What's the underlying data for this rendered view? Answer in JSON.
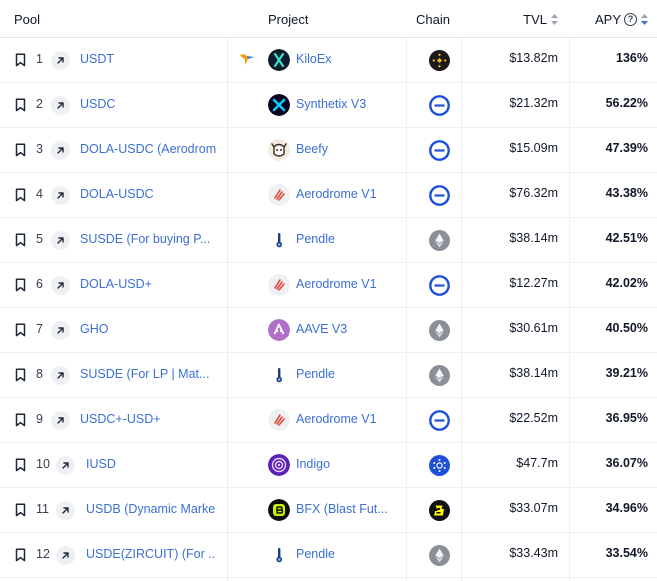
{
  "header": {
    "pool": "Pool",
    "project": "Project",
    "chain": "Chain",
    "tvl": "TVL",
    "apy": "APY",
    "apy_info_icon": "info-icon"
  },
  "colors": {
    "link": "#3b6fd6",
    "text": "#111827",
    "separator": "#eceef2"
  },
  "rows": [
    {
      "rank": "1",
      "pool": "USDT",
      "project": "KiloEx",
      "chain": "BNB Chain",
      "tvl": "$13.82m",
      "apy": "136%"
    },
    {
      "rank": "2",
      "pool": "USDC",
      "project": "Synthetix V3",
      "chain": "Base",
      "tvl": "$21.32m",
      "apy": "56.22%"
    },
    {
      "rank": "3",
      "pool": "DOLA-USDC (Aerodrome",
      "project": "Beefy",
      "chain": "Base",
      "tvl": "$15.09m",
      "apy": "47.39%"
    },
    {
      "rank": "4",
      "pool": "DOLA-USDC",
      "project": "Aerodrome V1",
      "chain": "Base",
      "tvl": "$76.32m",
      "apy": "43.38%"
    },
    {
      "rank": "5",
      "pool": "SUSDE (For buying P...",
      "project": "Pendle",
      "chain": "Ethereum",
      "tvl": "$38.14m",
      "apy": "42.51%"
    },
    {
      "rank": "6",
      "pool": "DOLA-USD+",
      "project": "Aerodrome V1",
      "chain": "Base",
      "tvl": "$12.27m",
      "apy": "42.02%"
    },
    {
      "rank": "7",
      "pool": "GHO",
      "project": "AAVE V3",
      "chain": "Ethereum",
      "tvl": "$30.61m",
      "apy": "40.50%"
    },
    {
      "rank": "8",
      "pool": "SUSDE (For LP | Mat...",
      "project": "Pendle",
      "chain": "Ethereum",
      "tvl": "$38.14m",
      "apy": "39.21%"
    },
    {
      "rank": "9",
      "pool": "USDC+-USD+",
      "project": "Aerodrome V1",
      "chain": "Base",
      "tvl": "$22.52m",
      "apy": "36.95%"
    },
    {
      "rank": "10",
      "pool": "IUSD",
      "project": "Indigo",
      "chain": "Cardano",
      "tvl": "$47.7m",
      "apy": "36.07%"
    },
    {
      "rank": "11",
      "pool": "USDB (Dynamic Marke",
      "project": "BFX (Blast Fut...",
      "chain": "Blast",
      "tvl": "$33.07m",
      "apy": "34.96%"
    },
    {
      "rank": "12",
      "pool": "USDE(ZIRCUIT) (For ...",
      "project": "Pendle",
      "chain": "Ethereum",
      "tvl": "$33.43m",
      "apy": "33.54%"
    }
  ]
}
